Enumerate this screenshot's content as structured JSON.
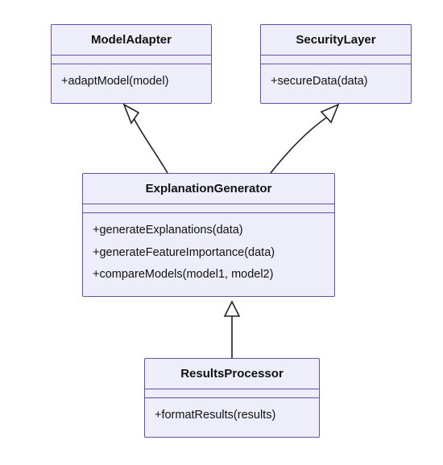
{
  "classes": {
    "modelAdapter": {
      "name": "ModelAdapter",
      "methods": [
        "+adaptModel(model)"
      ]
    },
    "securityLayer": {
      "name": "SecurityLayer",
      "methods": [
        "+secureData(data)"
      ]
    },
    "explanationGenerator": {
      "name": "ExplanationGenerator",
      "methods": [
        "+generateExplanations(data)",
        "+generateFeatureImportance(data)",
        "+compareModels(model1, model2)"
      ]
    },
    "resultsProcessor": {
      "name": "ResultsProcessor",
      "methods": [
        "+formatResults(results)"
      ]
    }
  },
  "relationships": [
    {
      "from": "ExplanationGenerator",
      "to": "ModelAdapter",
      "type": "inherits"
    },
    {
      "from": "ExplanationGenerator",
      "to": "SecurityLayer",
      "type": "inherits"
    },
    {
      "from": "ResultsProcessor",
      "to": "ExplanationGenerator",
      "type": "inherits"
    }
  ]
}
